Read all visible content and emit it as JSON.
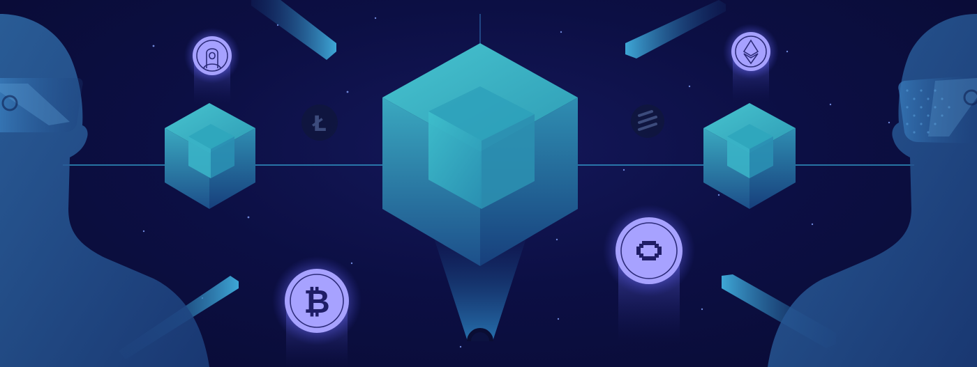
{
  "scene": {
    "title": "",
    "description_visible_text": []
  },
  "icons": {
    "center_cube": "cube-icon",
    "left_cube": "cube-icon",
    "right_cube": "cube-icon",
    "bitcoin_coin": "bitcoin-icon",
    "litecoin_coin": "litecoin-icon",
    "ethereum_coin": "ethereum-icon",
    "portrait_coin": "portrait-token-icon",
    "octagon_coin": "octagon-token-icon",
    "striped_coin": "stripes-token-icon",
    "left_figure": "person-with-vr-headset-icon",
    "right_figure": "person-with-vr-headset-icon"
  },
  "colors": {
    "background": "#0b0d3a",
    "cube_light": "#3fb6c6",
    "cube_mid": "#2b8aa8",
    "cube_dark": "#1b4f86",
    "coin_glow": "#8e8cff",
    "coin_face": "#a9a3ff",
    "figure": "#2a5e98"
  }
}
